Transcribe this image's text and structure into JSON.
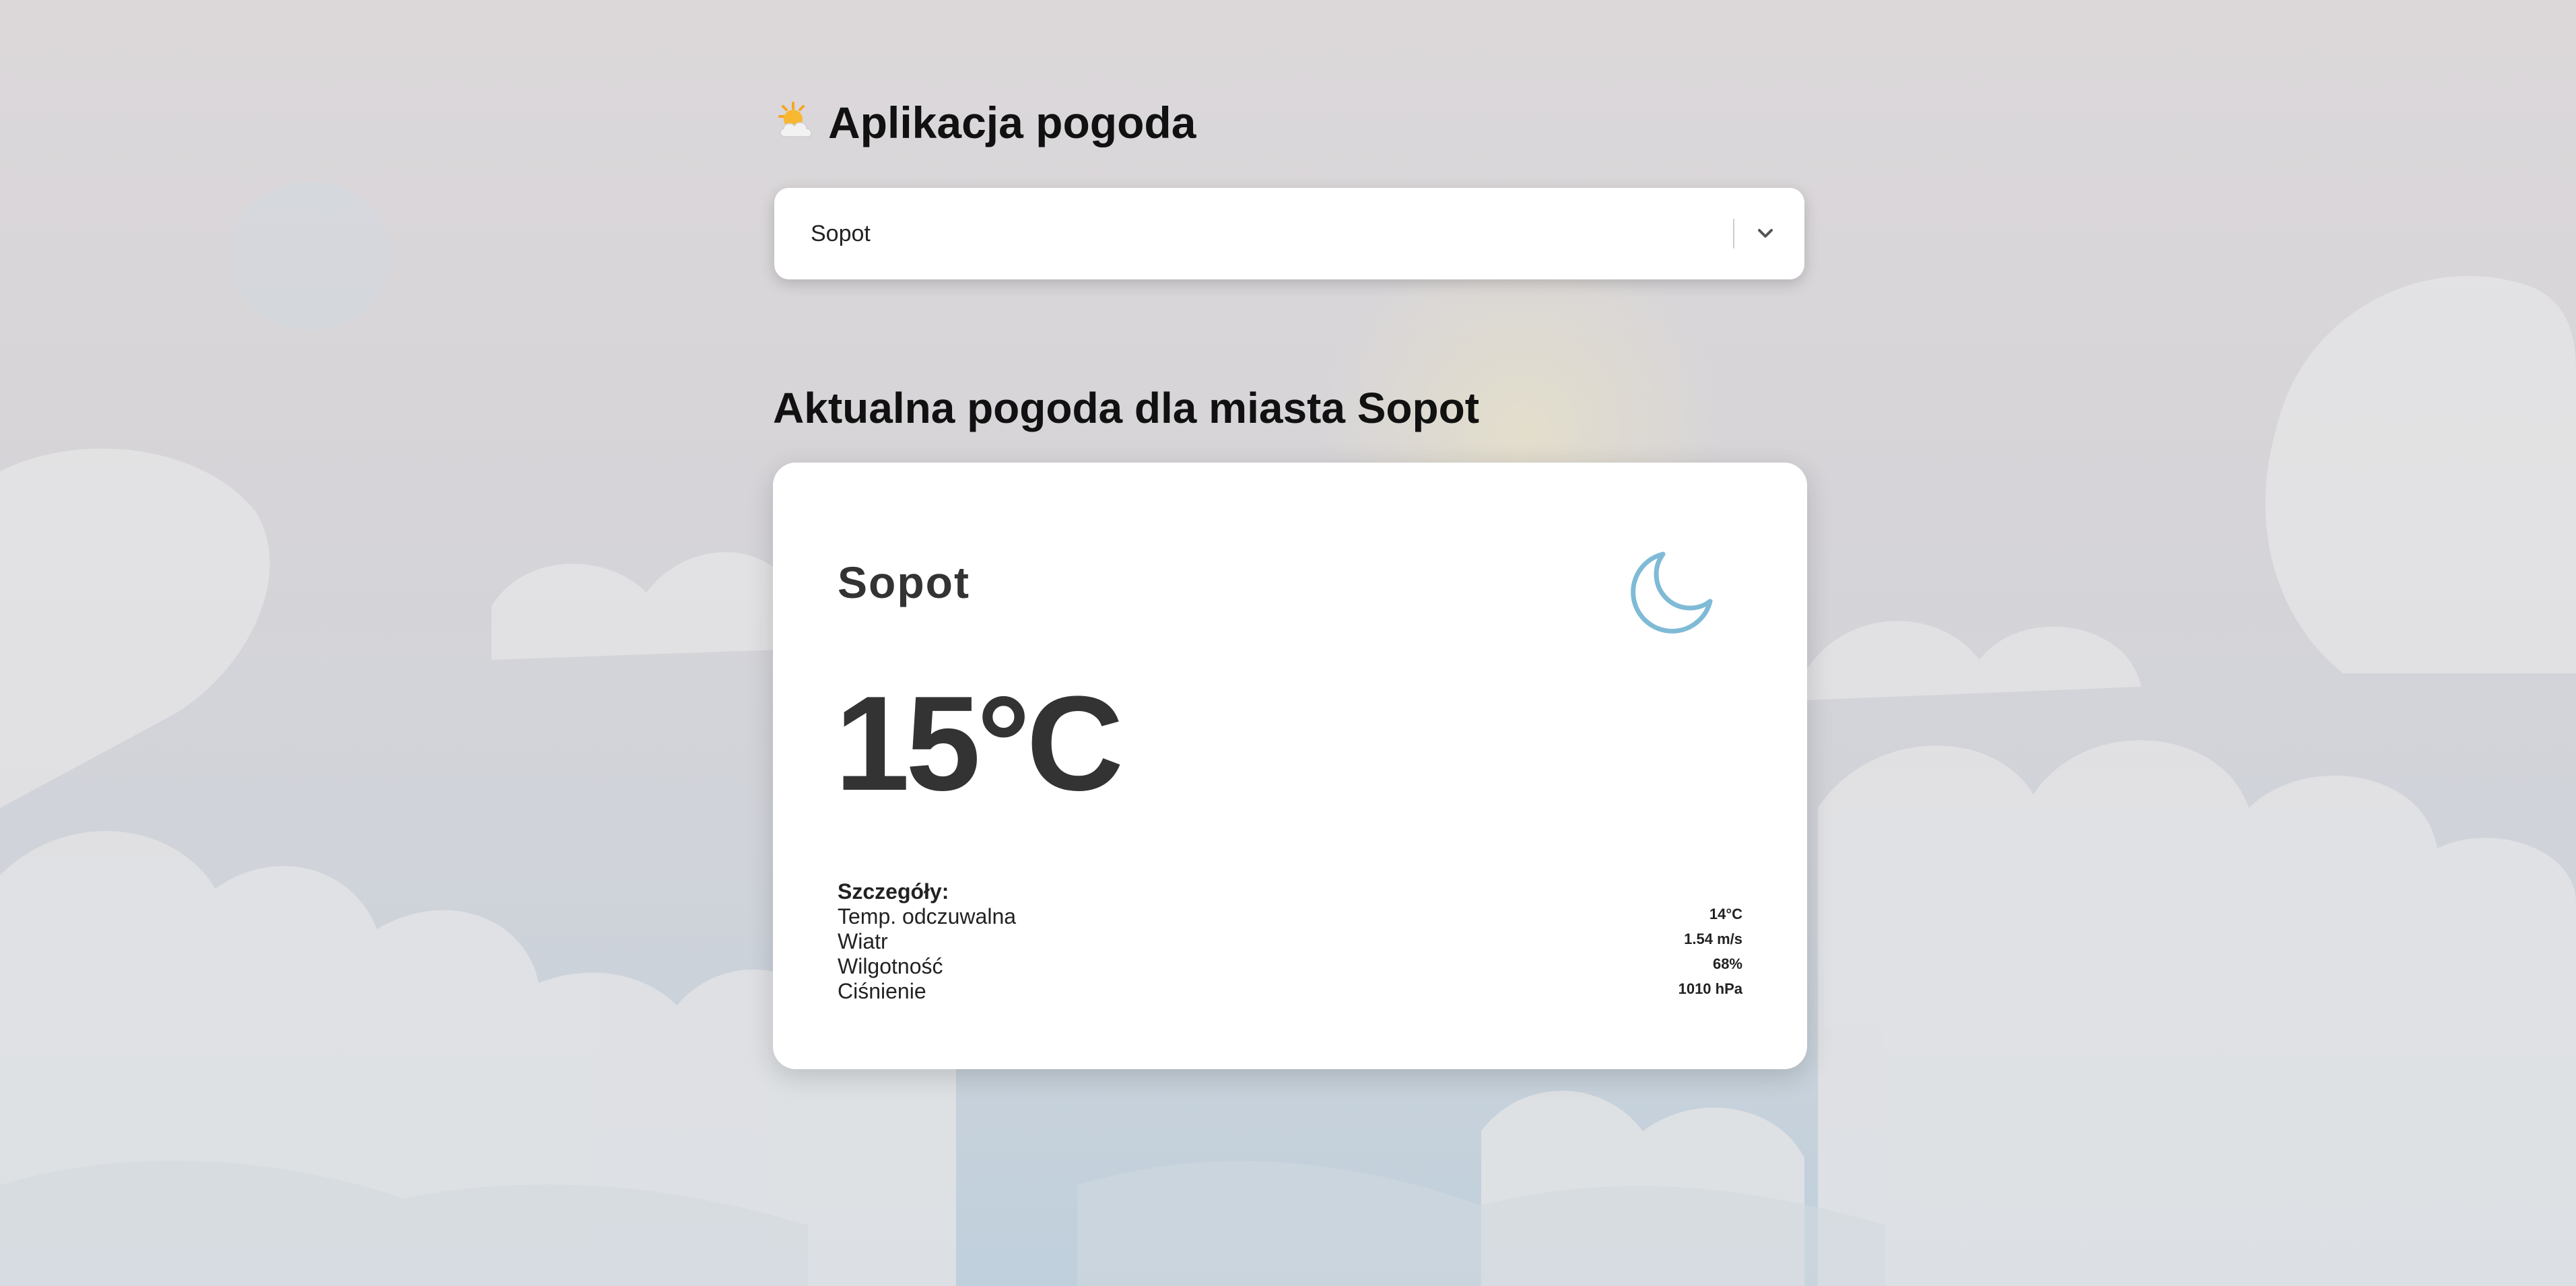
{
  "app": {
    "title": "Aplikacja pogoda",
    "title_icon": "sun-behind-cloud-icon"
  },
  "city_select": {
    "selected_value": "Sopot",
    "dropdown_icon": "chevron-down-icon"
  },
  "section": {
    "heading": "Aktualna pogoda dla miasta Sopot"
  },
  "weather_card": {
    "city": "Sopot",
    "temperature": "15°C",
    "condition_icon": "crescent-moon-icon",
    "icon_color": "#7fbad6",
    "details_heading": "Szczegóły:",
    "details": [
      {
        "label": "Temp. odczuwalna",
        "value": "14°C"
      },
      {
        "label": "Wiatr",
        "value": "1.54 m/s"
      },
      {
        "label": "Wilgotność",
        "value": "68%"
      },
      {
        "label": "Ciśnienie",
        "value": "1010 hPa"
      }
    ]
  }
}
